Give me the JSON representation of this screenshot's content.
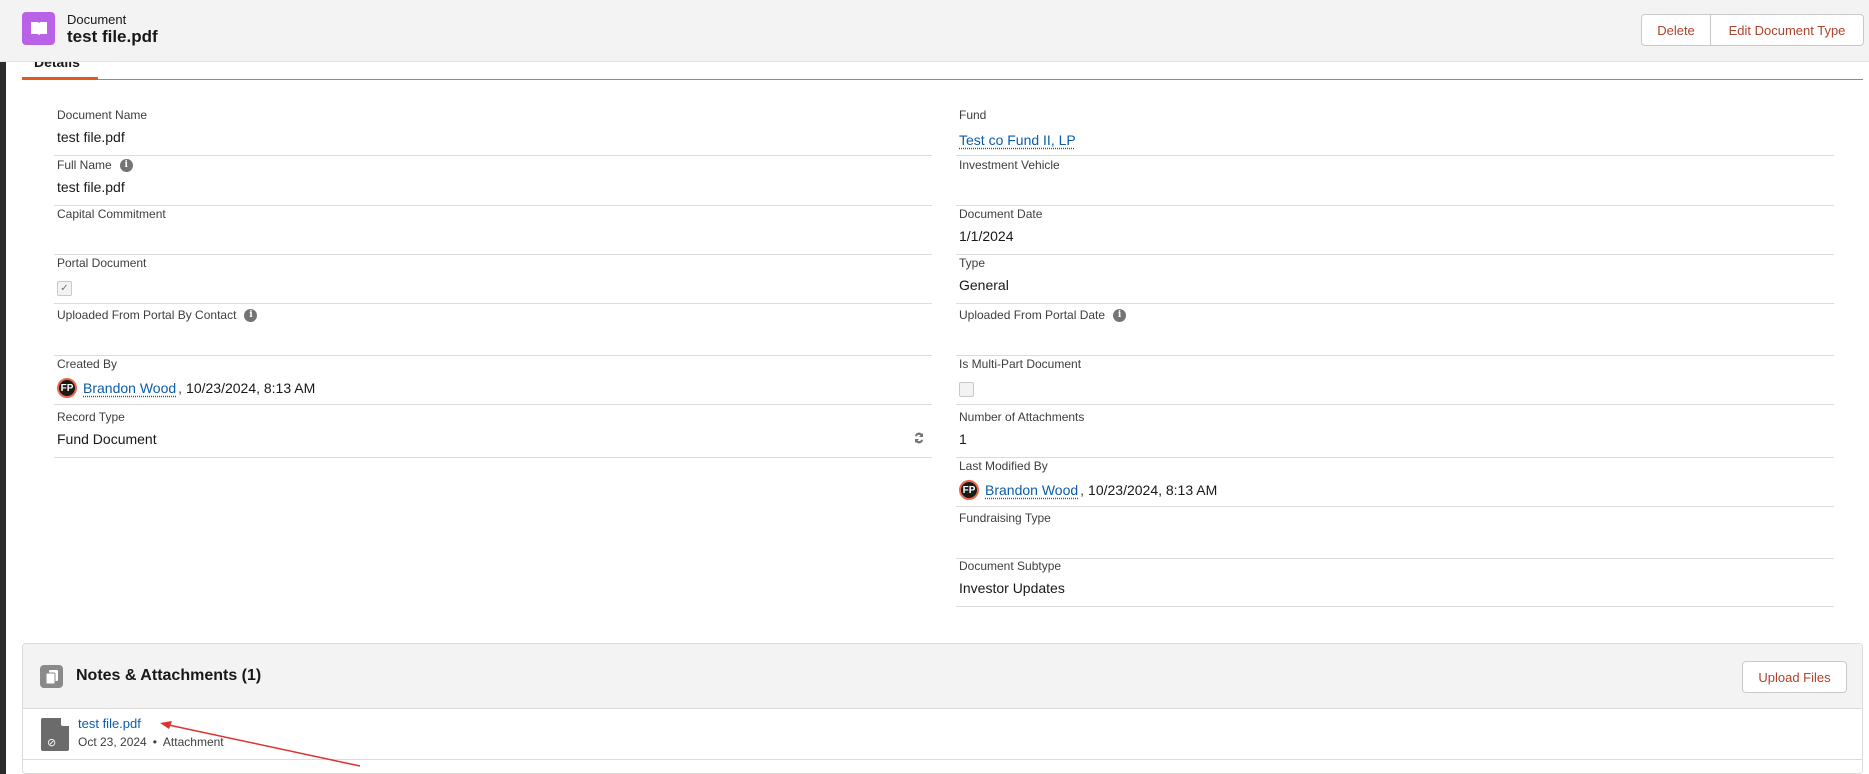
{
  "header": {
    "object_type": "Document",
    "title": "test file.pdf",
    "delete_label": "Delete",
    "edit_label": "Edit Document Type",
    "icon": "document-book-icon",
    "accent": "#b962e6"
  },
  "tabs": {
    "active_label": "Details"
  },
  "fields": {
    "document_name": {
      "label": "Document Name",
      "value": "test file.pdf"
    },
    "fund": {
      "label": "Fund",
      "value": "Test co Fund II, LP"
    },
    "full_name": {
      "label": "Full Name",
      "value": "test file.pdf"
    },
    "investment_vehicle": {
      "label": "Investment Vehicle",
      "value": ""
    },
    "capital_commitment": {
      "label": "Capital Commitment",
      "value": ""
    },
    "document_date": {
      "label": "Document Date",
      "value": "1/1/2024"
    },
    "portal_document": {
      "label": "Portal Document",
      "checked": true
    },
    "type": {
      "label": "Type",
      "value": "General"
    },
    "uploaded_by_contact": {
      "label": "Uploaded From Portal By Contact",
      "value": ""
    },
    "uploaded_date": {
      "label": "Uploaded From Portal Date",
      "value": ""
    },
    "created_by": {
      "label": "Created By",
      "user": "Brandon Wood",
      "date": "10/23/2024, 8:13 AM",
      "avatar": "FP"
    },
    "multi_part": {
      "label": "Is Multi-Part Document",
      "checked": false
    },
    "record_type": {
      "label": "Record Type",
      "value": "Fund Document"
    },
    "num_attachments": {
      "label": "Number of Attachments",
      "value": "1"
    },
    "last_modified_by": {
      "label": "Last Modified By",
      "user": "Brandon Wood",
      "date": "10/23/2024, 8:13 AM",
      "avatar": "FP"
    },
    "fundraising_type": {
      "label": "Fundraising Type",
      "value": ""
    },
    "document_subtype": {
      "label": "Document Subtype",
      "value": "Investor Updates"
    }
  },
  "notes": {
    "title": "Notes & Attachments (1)",
    "upload_label": "Upload Files",
    "files": [
      {
        "name": "test file.pdf",
        "date": "Oct 23, 2024",
        "kind": "Attachment"
      }
    ]
  },
  "colors": {
    "link": "#0b5cab",
    "button_text": "#b0432c",
    "tab_underline": "#e3581e",
    "annotation_arrow": "#e03131"
  }
}
